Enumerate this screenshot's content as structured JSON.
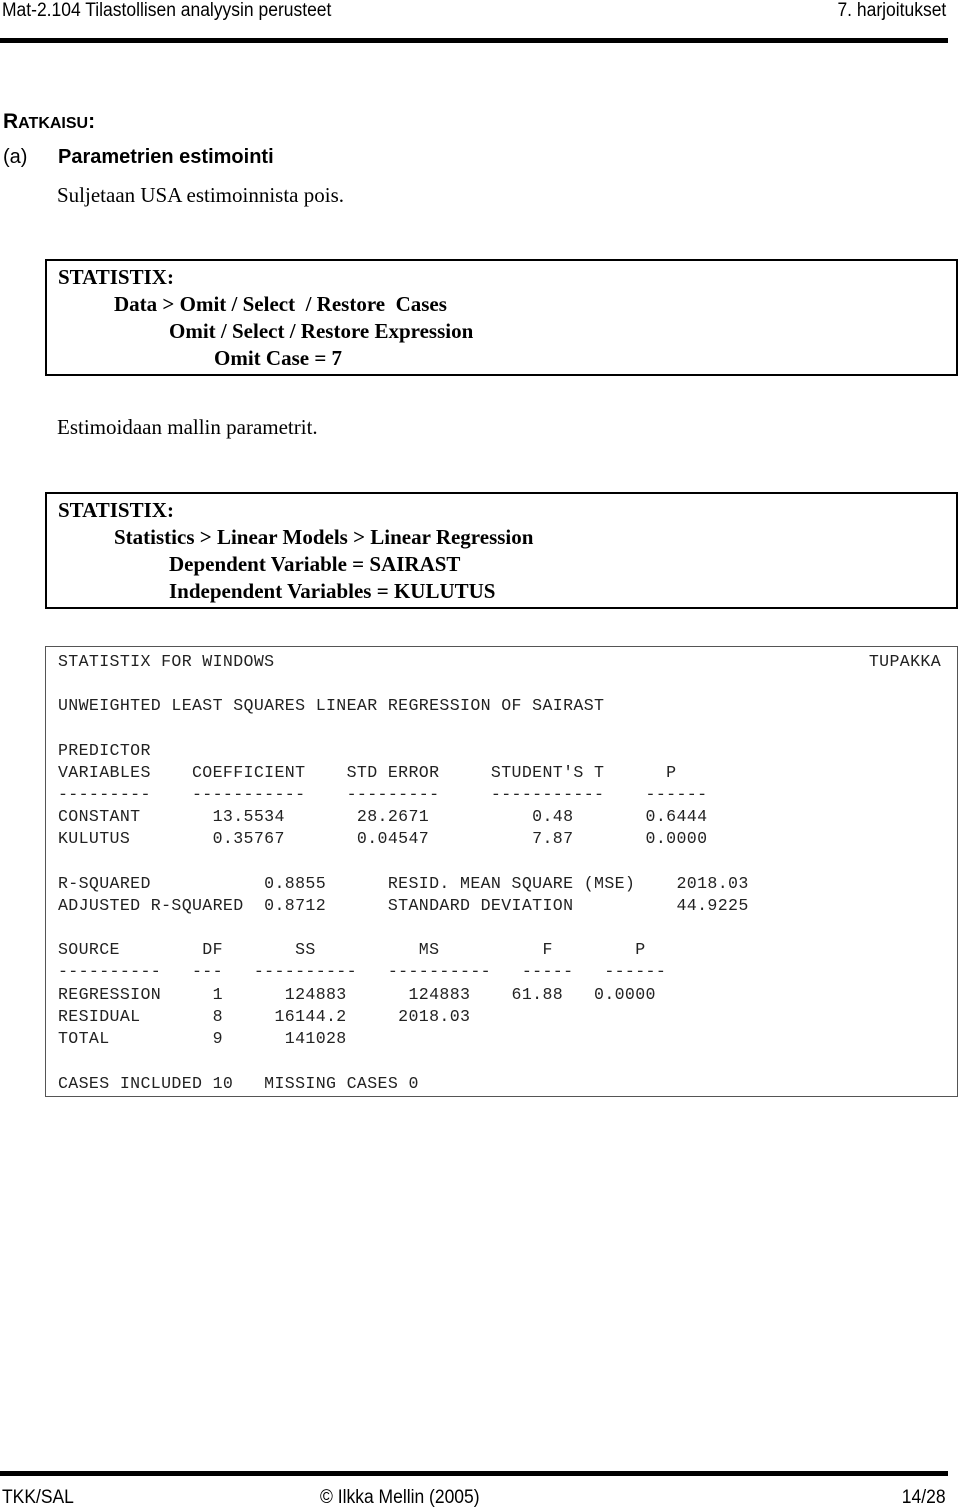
{
  "header": {
    "course_title": "Mat-2.104 Tilastollisen analyysin perusteet",
    "exercise": "7. harjoitukset"
  },
  "solution_heading": {
    "first_letter": "R",
    "rest": "ATKAISU",
    "colon": ":"
  },
  "section": {
    "number": "(a)",
    "title": "Parametrien estimointi"
  },
  "paragraphs": {
    "exclude_usa": "Suljetaan USA estimoinnista pois.",
    "estimate_params": "Estimoidaan mallin parametrit."
  },
  "box_omit": {
    "lines": [
      "STATISTIX:",
      "Data > Omit / Select  / Restore  Cases",
      "Omit / Select / Restore Expression",
      "Omit Case = 7"
    ]
  },
  "box_regression": {
    "lines": [
      "STATISTIX:",
      "Statistics > Linear Models > Linear Regression",
      "Dependent Variable = SAIRAST",
      "Independent Variables = KULUTUS"
    ]
  },
  "output": {
    "program": "STATISTIX FOR WINDOWS",
    "dataset": "TUPAKKA",
    "title": "UNWEIGHTED LEAST SQUARES LINEAR REGRESSION OF SAIRAST",
    "coef_header_1": "PREDICTOR",
    "coef_header_2": "VARIABLES    COEFFICIENT    STD ERROR     STUDENT'S T      P",
    "coef_rule": "---------    -----------    ---------     -----------    ------",
    "coef_rows": [
      "CONSTANT       13.5534       28.2671          0.48       0.6444",
      "KULUTUS        0.35767       0.04547          7.87       0.0000"
    ],
    "coefficients": [
      {
        "variable": "CONSTANT",
        "coefficient": "13.5534",
        "std_error": "28.2671",
        "t": "0.48",
        "p": "0.6444"
      },
      {
        "variable": "KULUTUS",
        "coefficient": "0.35767",
        "std_error": "0.04547",
        "t": "7.87",
        "p": "0.0000"
      }
    ],
    "fit_rows": [
      "R-SQUARED           0.8855      RESID. MEAN SQUARE (MSE)    2018.03",
      "ADJUSTED R-SQUARED  0.8712      STANDARD DEVIATION          44.9225"
    ],
    "fit": {
      "r_squared": "0.8855",
      "adj_r_squared": "0.8712",
      "mse": "2018.03",
      "std_dev": "44.9225"
    },
    "anova_header": "SOURCE        DF       SS          MS          F        P",
    "anova_rule": "----------   ---   ----------   ----------   -----   ------",
    "anova_rows": [
      "REGRESSION     1      124883      124883    61.88   0.0000",
      "RESIDUAL       8     16144.2     2018.03",
      "TOTAL          9      141028"
    ],
    "anova": [
      {
        "source": "REGRESSION",
        "df": "1",
        "ss": "124883",
        "ms": "124883",
        "f": "61.88",
        "p": "0.0000"
      },
      {
        "source": "RESIDUAL",
        "df": "8",
        "ss": "16144.2",
        "ms": "2018.03"
      },
      {
        "source": "TOTAL",
        "df": "9",
        "ss": "141028"
      }
    ],
    "cases": "CASES INCLUDED 10   MISSING CASES 0"
  },
  "footer": {
    "org": "TKK/SAL",
    "copyright": "© Ilkka Mellin (2005)",
    "page": "14/28"
  }
}
